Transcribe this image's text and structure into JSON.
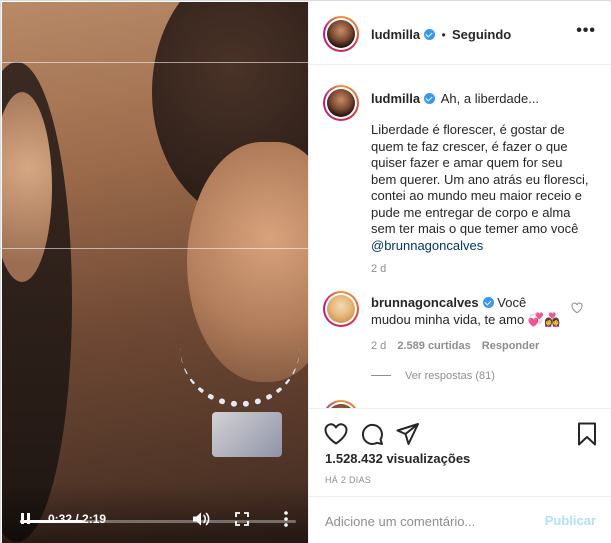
{
  "video": {
    "current_time": "0:32",
    "duration": "2:19",
    "time_separator": " / ",
    "progress": 0.23
  },
  "header": {
    "username": "ludmilla",
    "separator": "•",
    "follow_status": "Seguindo",
    "more_label": "•••"
  },
  "caption": {
    "username": "ludmilla",
    "title": "Ah, a liberdade...",
    "body": "Liberdade é florescer, é gostar de quem te faz crescer, é fazer o que quiser fazer e amar quem for seu bem querer. Um ano atrás eu floresci, contei ao mundo meu maior receio e pude me entregar de corpo e alma sem ter mais o que temer amo você",
    "mention": "@brunnagoncalves",
    "age": "2 d"
  },
  "comment": {
    "username": "brunnagoncalves",
    "text": "Você mudou minha vida, te amo",
    "emoji": "💞👩‍❤️‍👩",
    "age": "2 d",
    "likes": "2.589 curtidas",
    "reply_label": "Responder",
    "view_replies": "Ver respostas (81)"
  },
  "stats": {
    "views": "1.528.432 visualizações",
    "posted": "HÁ 2 DIAS"
  },
  "comment_input": {
    "placeholder": "Adicione um comentário...",
    "publish_label": "Publicar"
  },
  "colors": {
    "verified": "#3897f0",
    "link": "#00376b",
    "muted": "#8e8e8e",
    "publish_disabled": "#b2dffc"
  }
}
